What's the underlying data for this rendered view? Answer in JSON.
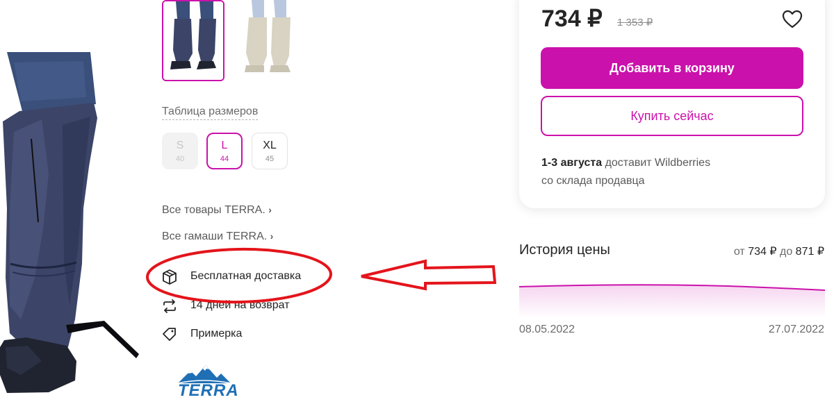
{
  "gallery": {
    "main_image": "product-photo-navy-gaiters",
    "thumbnails": [
      "navy-gaiters-thumb",
      "beige-gaiters-thumb"
    ]
  },
  "sizes": {
    "table_link": "Таблица размеров",
    "options": [
      {
        "letter": "S",
        "num": "40",
        "state": "unavailable"
      },
      {
        "letter": "L",
        "num": "44",
        "state": "selected"
      },
      {
        "letter": "XL",
        "num": "45",
        "state": "available"
      }
    ]
  },
  "links": {
    "all_goods": "Все товары TERRA.",
    "all_gaiters": "Все гамаши TERRA."
  },
  "features": [
    {
      "icon": "box-icon",
      "label": "Бесплатная доставка"
    },
    {
      "icon": "return-arrows-icon",
      "label": "14 дней на возврат"
    },
    {
      "icon": "tag-icon",
      "label": "Примерка"
    }
  ],
  "brand": {
    "logo_text": "TERRA"
  },
  "buy_card": {
    "price": "734 ₽",
    "old_price": "1 353 ₽",
    "add_to_cart": "Добавить в корзину",
    "buy_now": "Купить сейчас",
    "delivery_date": "1-3 августа",
    "delivery_by": "доставит Wildberries",
    "delivery_from": "со склада продавца"
  },
  "price_history": {
    "title": "История цены",
    "from_word": "от",
    "min_price": "734 ₽",
    "to_word": "до",
    "max_price": "871 ₽",
    "date_start": "08.05.2022",
    "date_end": "27.07.2022"
  },
  "chart_data": {
    "type": "area",
    "x": [
      "08.05.2022",
      "27.07.2022"
    ],
    "series": [
      {
        "values": [
          871,
          871
        ]
      }
    ]
  },
  "colors": {
    "accent": "#cb11ab",
    "annotation": "#e4141b"
  }
}
